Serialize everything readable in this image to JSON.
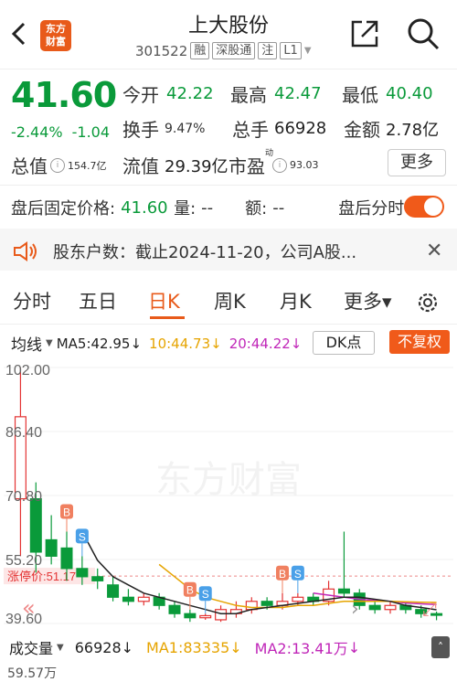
{
  "header": {
    "logo_line1": "东方",
    "logo_line2": "财富",
    "title": "上大股份",
    "code": "301522",
    "tags": [
      "融",
      "深股通",
      "注",
      "L1"
    ]
  },
  "quote": {
    "price": "41.60",
    "change_pct": "-2.44%",
    "change_amt": "-1.04",
    "open_label": "今开",
    "open": "42.22",
    "high_label": "最高",
    "high": "42.47",
    "low_label": "最低",
    "low": "40.40",
    "turnover_label": "换手",
    "turnover": "9.47%",
    "volume_label": "总手",
    "volume": "66928",
    "amount_label": "金额",
    "amount": "2.78亿",
    "mktcap_label": "总值",
    "mktcap": "154.7亿",
    "float_label": "流值",
    "float": "29.39亿",
    "pe_label": "市盈",
    "pe_super": "动",
    "pe": "93.03",
    "more_label": "更多"
  },
  "after_hours": {
    "price_label": "盘后固定价格:",
    "price": "41.60",
    "vol_label": "量:",
    "vol": "--",
    "amt_label": "额:",
    "amt": "--",
    "timeshare_label": "盘后分时"
  },
  "notice": {
    "text": "股东户数：截止2024-11-20，公司A股..."
  },
  "tabs": [
    "分时",
    "五日",
    "日K",
    "周K",
    "月K",
    "更多▾"
  ],
  "active_tab": "日K",
  "chart_bar": {
    "ma_label": "均线",
    "ma5": "MA5:42.95",
    "ma10": "10:44.73",
    "ma20": "20:44.22",
    "dk_label": "DK点",
    "fq_label": "不复权"
  },
  "colors": {
    "accent": "#e85a1a",
    "up": "#e33333",
    "down": "#0a9a3a",
    "ma5": "#222222",
    "ma10": "#e6a400",
    "ma20": "#c026b8",
    "marker_b": "#f08060",
    "marker_s": "#4aa0e8"
  },
  "chart_data": {
    "type": "candlestick",
    "y_ticks": [
      "102.00",
      "86.40",
      "70.80",
      "55.20",
      "39.60"
    ],
    "ylim": [
      39.6,
      102.0
    ],
    "limit_label": "涨停价:51.17",
    "limit_value": 51.17,
    "watermark": "东方财富",
    "candles": [
      {
        "o": 70,
        "c": 90,
        "h": 102,
        "l": 56
      },
      {
        "o": 70,
        "c": 57,
        "h": 74,
        "l": 52
      },
      {
        "o": 60,
        "c": 56,
        "h": 66,
        "l": 54
      },
      {
        "o": 58,
        "c": 53,
        "h": 62,
        "l": 50
      },
      {
        "o": 53,
        "c": 51,
        "h": 56,
        "l": 49
      },
      {
        "o": 51,
        "c": 50,
        "h": 53,
        "l": 48
      },
      {
        "o": 49,
        "c": 46,
        "h": 51,
        "l": 45
      },
      {
        "o": 46,
        "c": 45,
        "h": 48,
        "l": 44
      },
      {
        "o": 45,
        "c": 46,
        "h": 47,
        "l": 44
      },
      {
        "o": 46,
        "c": 44,
        "h": 47,
        "l": 43
      },
      {
        "o": 44,
        "c": 42,
        "h": 45,
        "l": 41
      },
      {
        "o": 42,
        "c": 41,
        "h": 43,
        "l": 40
      },
      {
        "o": 41,
        "c": 41.5,
        "h": 42,
        "l": 40.5
      },
      {
        "o": 40.5,
        "c": 43,
        "h": 44,
        "l": 40
      },
      {
        "o": 42,
        "c": 43,
        "h": 45,
        "l": 41
      },
      {
        "o": 43,
        "c": 45,
        "h": 46,
        "l": 42
      },
      {
        "o": 45,
        "c": 44,
        "h": 46,
        "l": 43
      },
      {
        "o": 44,
        "c": 45,
        "h": 47,
        "l": 43
      },
      {
        "o": 45,
        "c": 46,
        "h": 47,
        "l": 44
      },
      {
        "o": 46,
        "c": 45,
        "h": 47,
        "l": 44
      },
      {
        "o": 45,
        "c": 48,
        "h": 50,
        "l": 44
      },
      {
        "o": 48,
        "c": 47,
        "h": 62,
        "l": 46
      },
      {
        "o": 47,
        "c": 44,
        "h": 48,
        "l": 43
      },
      {
        "o": 44,
        "c": 43,
        "h": 45,
        "l": 42
      },
      {
        "o": 43,
        "c": 44,
        "h": 45,
        "l": 42
      },
      {
        "o": 44,
        "c": 43,
        "h": 45,
        "l": 42
      },
      {
        "o": 43,
        "c": 42,
        "h": 44,
        "l": 41
      },
      {
        "o": 42,
        "c": 41.6,
        "h": 42.5,
        "l": 40.4
      }
    ],
    "ma5": [
      null,
      null,
      null,
      null,
      62,
      55,
      51,
      49,
      47,
      46,
      45,
      44,
      43,
      42,
      42,
      43,
      43.5,
      44,
      44.5,
      45,
      45.5,
      46,
      46,
      45.5,
      45,
      44,
      43.5,
      42.95
    ],
    "ma10": [
      null,
      null,
      null,
      null,
      null,
      null,
      null,
      null,
      null,
      54,
      51,
      48,
      46,
      45,
      44,
      43.5,
      43.5,
      43.5,
      44,
      44,
      44.5,
      45,
      45,
      45,
      45,
      44.9,
      44.8,
      44.73
    ],
    "ma20": [
      null,
      null,
      null,
      null,
      null,
      null,
      null,
      null,
      null,
      null,
      null,
      null,
      null,
      null,
      null,
      null,
      null,
      null,
      null,
      47,
      46.5,
      46,
      45.5,
      45.2,
      45,
      44.6,
      44.4,
      44.22
    ],
    "markers": [
      {
        "type": "B",
        "index": 3
      },
      {
        "type": "S",
        "index": 4
      },
      {
        "type": "B",
        "index": 11
      },
      {
        "type": "S",
        "index": 12
      },
      {
        "type": "B",
        "index": 17
      },
      {
        "type": "S",
        "index": 18
      }
    ]
  },
  "volume_bar": {
    "label": "成交量",
    "value": "66928",
    "ma1": "MA1:83335",
    "ma2": "MA2:13.41万",
    "bottom_value": "59.57万"
  }
}
